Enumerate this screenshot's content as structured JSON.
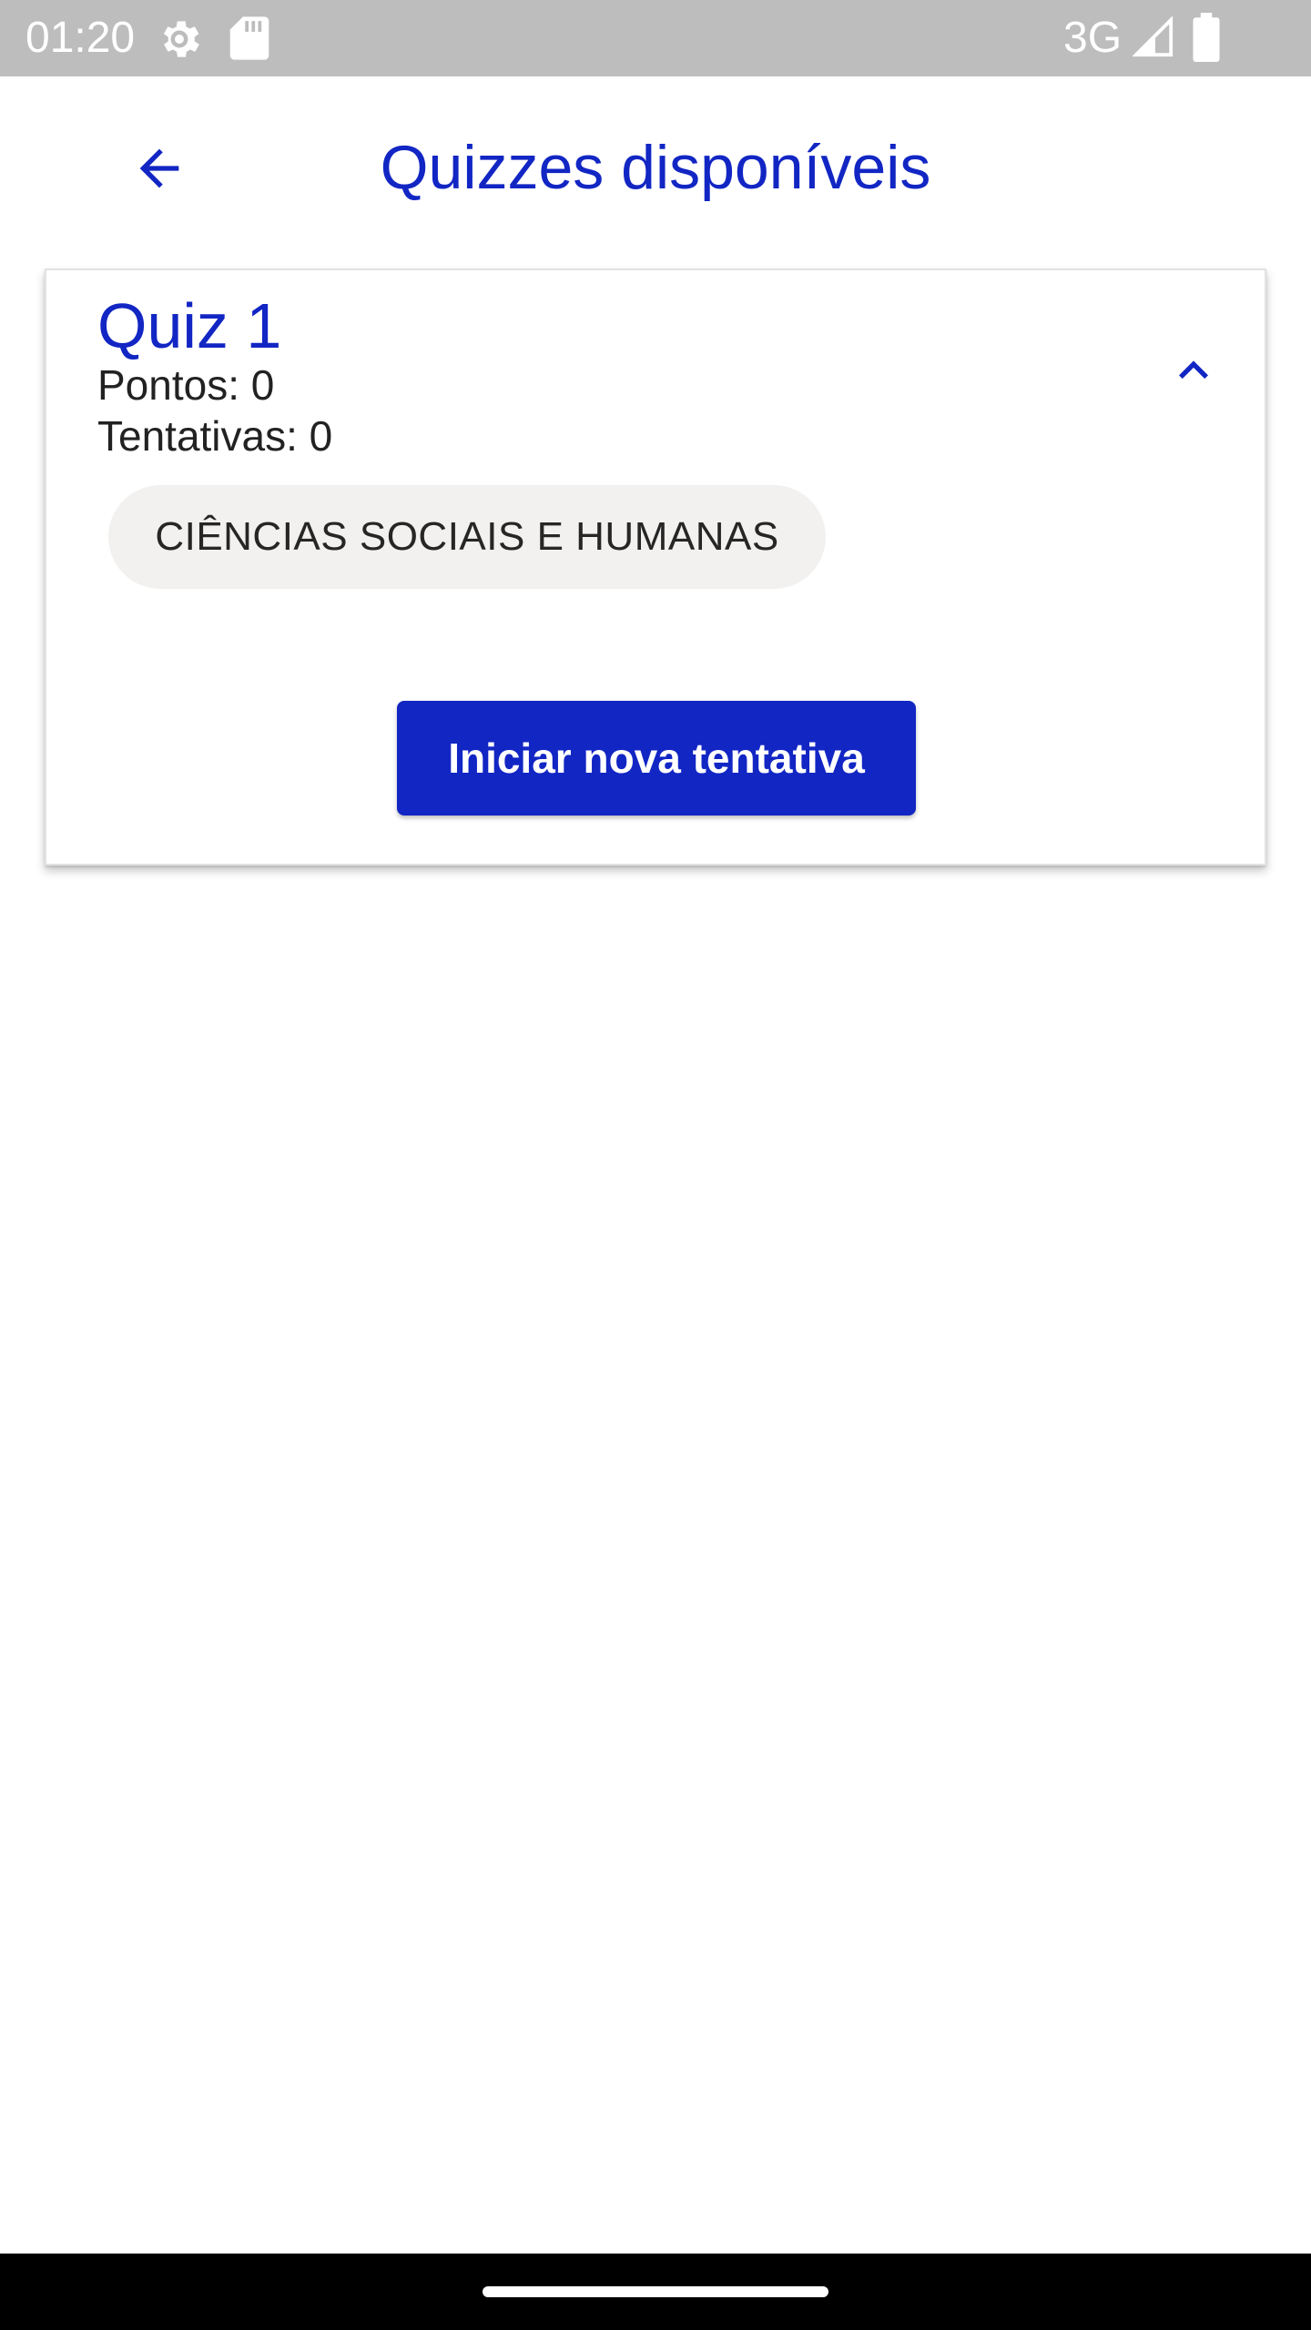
{
  "status_bar": {
    "time": "01:20",
    "network": "3G",
    "icons": [
      "settings-gear-icon",
      "sd-card-icon",
      "signal-icon",
      "battery-icon"
    ]
  },
  "header": {
    "title": "Quizzes disponíveis",
    "back_icon": "arrow-back-icon"
  },
  "quiz": {
    "title": "Quiz 1",
    "points": "Pontos: 0",
    "attempts": "Tentativas: 0",
    "category": "CIÊNCIAS SOCIAIS E HUMANAS",
    "start_button": "Iniciar nova tentativa",
    "collapse_icon": "chevron-up-icon"
  },
  "colors": {
    "primary": "#1226c4",
    "status_bar": "#bdbdbd",
    "chip_background": "#f2f1ef"
  }
}
